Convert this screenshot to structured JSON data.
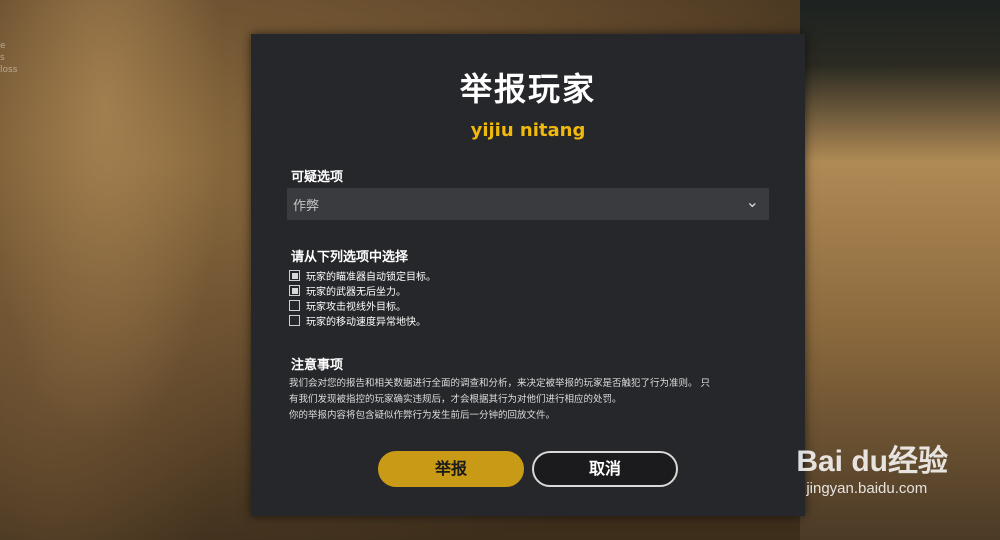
{
  "background_hud": [
    "e",
    "s",
    "loss"
  ],
  "dialog": {
    "title": "举报玩家",
    "player_name": "yijiu nitang",
    "suspect_label": "可疑选项",
    "suspect_select": {
      "selected": "作弊"
    },
    "choose_label": "请从下列选项中选择",
    "options": [
      {
        "label": "玩家的瞄准器自动锁定目标。",
        "checked": true
      },
      {
        "label": "玩家的武器无后坐力。",
        "checked": true
      },
      {
        "label": "玩家攻击视线外目标。",
        "checked": false
      },
      {
        "label": "玩家的移动速度异常地快。",
        "checked": false
      }
    ],
    "notes_title": "注意事项",
    "notes_line1": "我们会对您的报告和相关数据进行全面的调查和分析，来决定被举报的玩家是否触犯了行为准则。 只",
    "notes_line2": "有我们发现被指控的玩家确实违规后，才会根据其行为对他们进行相应的处罚。",
    "notes_line3": "你的举报内容将包含疑似作弊行为发生前后一分钟的回放文件。",
    "report_button": "举报",
    "cancel_button": "取消"
  },
  "watermark": {
    "brand": "Bai du经验",
    "url": "jingyan.baidu.com"
  },
  "colors": {
    "accent": "#c99a16",
    "player_name": "#f0b90b",
    "dialog_bg": "#26272a"
  }
}
